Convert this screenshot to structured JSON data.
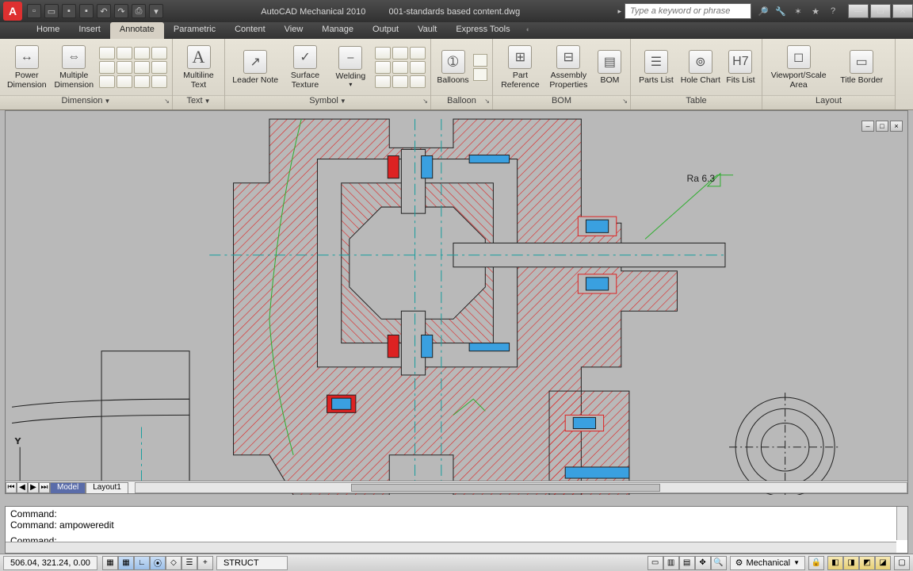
{
  "title": {
    "app": "AutoCAD Mechanical 2010",
    "file": "001-standards based content.dwg"
  },
  "search": {
    "placeholder": "Type a keyword or phrase"
  },
  "tabs": [
    "Home",
    "Insert",
    "Annotate",
    "Parametric",
    "Content",
    "View",
    "Manage",
    "Output",
    "Vault",
    "Express Tools"
  ],
  "active_tab": "Annotate",
  "panels": {
    "dimension": {
      "title": "Dimension",
      "btn_power": "Power\nDimension",
      "btn_multi": "Multiple\nDimension"
    },
    "text": {
      "title": "Text",
      "btn": "Multiline\nText"
    },
    "symbol": {
      "title": "Symbol",
      "leader": "Leader Note",
      "surface": "Surface\nTexture",
      "welding": "Welding"
    },
    "balloon": {
      "title": "Balloon",
      "btn": "Balloons"
    },
    "bom": {
      "title": "BOM",
      "part": "Part\nReference",
      "assy": "Assembly\nProperties",
      "bom": "BOM"
    },
    "table": {
      "title": "Table",
      "parts": "Parts List",
      "hole": "Hole Chart",
      "fits": "Fits List"
    },
    "layout": {
      "title": "Layout",
      "viewport": "Viewport/Scale\nArea",
      "titleb": "Title Border"
    }
  },
  "annotation": {
    "ra": "Ra 6.3"
  },
  "layout_tabs": {
    "model": "Model",
    "layout1": "Layout1"
  },
  "command": {
    "line1": "Command:",
    "line2": "Command: ampoweredit",
    "prompt": "Command:"
  },
  "status": {
    "coords": "506.04, 321.24, 0.00",
    "layer": "STRUCT",
    "workspace": "Mechanical"
  }
}
